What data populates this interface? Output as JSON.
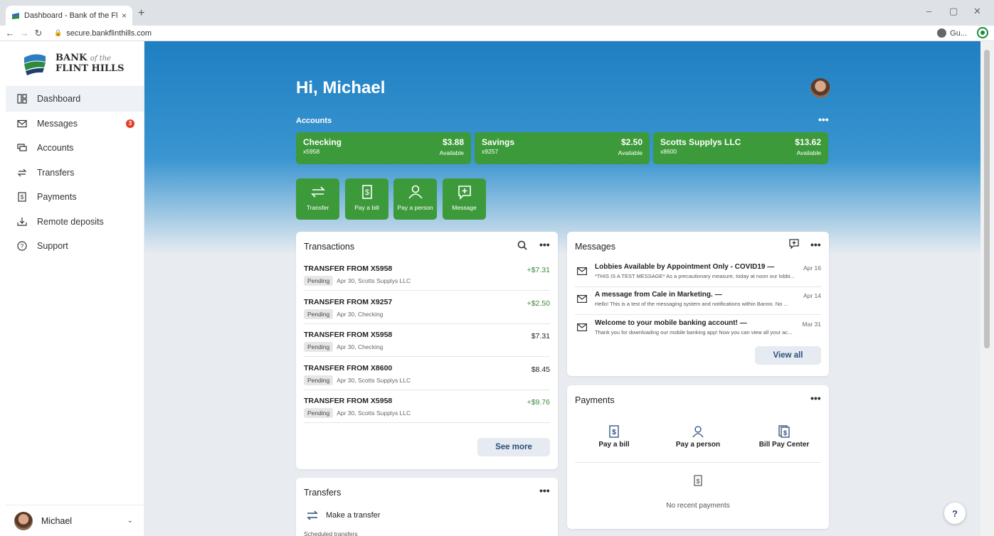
{
  "browser": {
    "tab_title": "Dashboard - Bank of the Flint Hil",
    "tab_close": "×",
    "new_tab": "+",
    "url": "secure.bankflinthills.com",
    "profile": "Gu...",
    "win_min": "–",
    "win_max": "▢",
    "win_close": "✕"
  },
  "sidebar": {
    "brand_line1": "BANK",
    "brand_of": "of the",
    "brand_line2": "FLINT HILLS",
    "items": [
      {
        "label": "Dashboard",
        "icon": "dashboard-icon",
        "active": true
      },
      {
        "label": "Messages",
        "icon": "mail-icon",
        "badge": "3"
      },
      {
        "label": "Accounts",
        "icon": "accounts-icon"
      },
      {
        "label": "Transfers",
        "icon": "transfer-icon"
      },
      {
        "label": "Payments",
        "icon": "bill-icon"
      },
      {
        "label": "Remote deposits",
        "icon": "deposit-icon"
      },
      {
        "label": "Support",
        "icon": "help-icon"
      }
    ],
    "user": "Michael"
  },
  "header": {
    "greeting": "Hi, Michael",
    "accounts_label": "Accounts",
    "more": "•••"
  },
  "accounts": [
    {
      "name": "Checking",
      "number": "x5958",
      "balance": "$3.88",
      "status": "Available"
    },
    {
      "name": "Savings",
      "number": "x9257",
      "balance": "$2.50",
      "status": "Available"
    },
    {
      "name": "Scotts Supplys LLC",
      "number": "x8600",
      "balance": "$13.62",
      "status": "Available"
    }
  ],
  "quick_actions": [
    {
      "label": "Transfer",
      "icon": "transfer-icon"
    },
    {
      "label": "Pay a bill",
      "icon": "bill-icon"
    },
    {
      "label": "Pay a person",
      "icon": "person-icon"
    },
    {
      "label": "Message",
      "icon": "compose-icon"
    }
  ],
  "transactions": {
    "title": "Transactions",
    "more": "•••",
    "items": [
      {
        "title": "TRANSFER FROM X5958",
        "status": "Pending",
        "detail": "Apr 30, Scotts Supplys LLC",
        "amount": "+$7.31",
        "positive": true
      },
      {
        "title": "TRANSFER FROM X9257",
        "status": "Pending",
        "detail": "Apr 30, Checking",
        "amount": "+$2.50",
        "positive": true
      },
      {
        "title": "TRANSFER FROM X5958",
        "status": "Pending",
        "detail": "Apr 30, Checking",
        "amount": "$7.31",
        "positive": false
      },
      {
        "title": "TRANSFER FROM X8600",
        "status": "Pending",
        "detail": "Apr 30, Scotts Supplys LLC",
        "amount": "$8.45",
        "positive": false
      },
      {
        "title": "TRANSFER FROM X5958",
        "status": "Pending",
        "detail": "Apr 30, Scotts Supplys LLC",
        "amount": "+$9.76",
        "positive": true
      }
    ],
    "see_more": "See more"
  },
  "messages": {
    "title": "Messages",
    "more": "•••",
    "items": [
      {
        "subject": "Lobbies Available by Appointment Only - COVID19 —",
        "date": "Apr 16",
        "preview": "*THIS IS A TEST MESSAGE* As a precautionary measure, today at noon our lobbi..."
      },
      {
        "subject": "A message from Cale in Marketing. —",
        "date": "Apr 14",
        "preview": "Hello! This is a test of the messaging system and notifications within Banno. No ..."
      },
      {
        "subject": "Welcome to your mobile banking account! —",
        "date": "Mar 31",
        "preview": "Thank you for downloading our mobile banking app! Now you can view all your ac..."
      }
    ],
    "view_all": "View all"
  },
  "payments": {
    "title": "Payments",
    "more": "•••",
    "actions": [
      {
        "label": "Pay a bill",
        "icon": "bill-icon"
      },
      {
        "label": "Pay a person",
        "icon": "person-icon"
      },
      {
        "label": "Bill Pay Center",
        "icon": "bill-center-icon"
      }
    ],
    "empty": "No recent payments"
  },
  "transfers": {
    "title": "Transfers",
    "more": "•••",
    "make": "Make a transfer",
    "scheduled": "Scheduled transfers"
  },
  "help_button": "?",
  "colors": {
    "accent_green": "#3d9a3a",
    "hero_blue": "#1f7fc2",
    "badge_red": "#e53c24"
  }
}
